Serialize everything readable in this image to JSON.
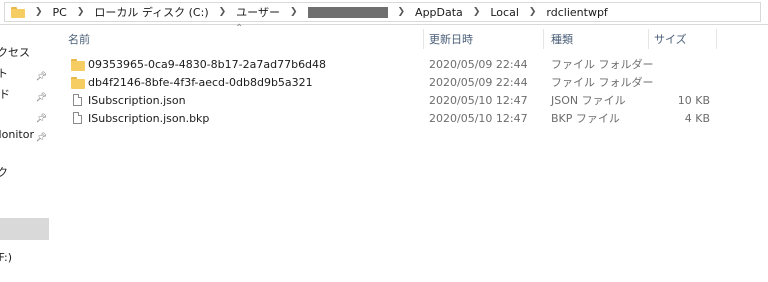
{
  "address_bar": {
    "crumbs": [
      "PC",
      "ローカル ディスク (C:)",
      "ユーザー",
      "",
      "AppData",
      "Local",
      "rdclientwpf"
    ]
  },
  "nav": {
    "items": [
      {
        "label": "アクセス",
        "pinned": false
      },
      {
        "label": "ト",
        "pinned": true
      },
      {
        "label": "ド",
        "pinned": true
      },
      {
        "label": "",
        "pinned": true
      },
      {
        "label": "Monitor",
        "pinned": true
      },
      {
        "label": "ク",
        "pinned": false
      },
      {
        "label": "F:)",
        "pinned": false
      }
    ]
  },
  "columns": {
    "name": "名前",
    "modified": "更新日時",
    "type": "種類",
    "size": "サイズ"
  },
  "files": [
    {
      "name": "09353965-0ca9-4830-8b17-2a7ad77b6d48",
      "modified": "2020/05/09 22:44",
      "type": "ファイル フォルダー",
      "size": "",
      "kind": "folder"
    },
    {
      "name": "db4f2146-8bfe-4f3f-aecd-0db8d9b5a321",
      "modified": "2020/05/09 22:44",
      "type": "ファイル フォルダー",
      "size": "",
      "kind": "folder"
    },
    {
      "name": "ISubscription.json",
      "modified": "2020/05/10 12:47",
      "type": "JSON ファイル",
      "size": "10 KB",
      "kind": "file"
    },
    {
      "name": "ISubscription.json.bkp",
      "modified": "2020/05/10 12:47",
      "type": "BKP ファイル",
      "size": "4 KB",
      "kind": "file"
    }
  ]
}
